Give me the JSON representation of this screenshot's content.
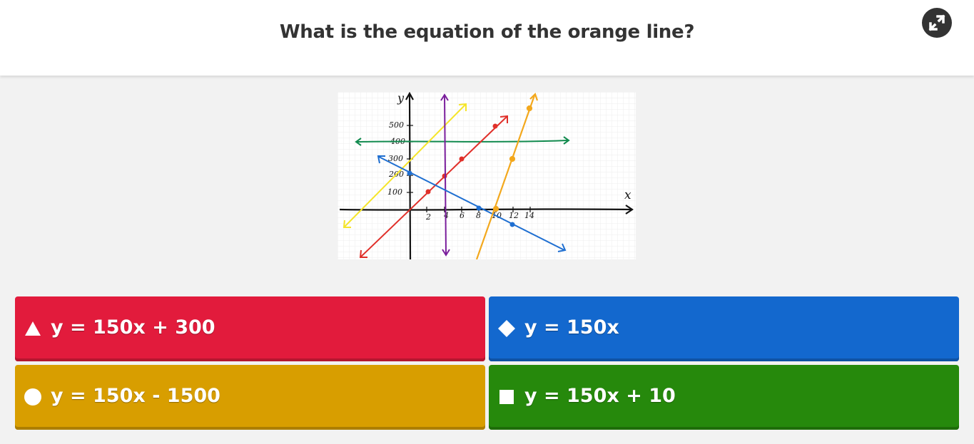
{
  "question": {
    "text": "What is the equation of the orange line?"
  },
  "header": {
    "fullscreen_icon": "expand-icon"
  },
  "graph": {
    "x_axis_label": "x",
    "y_axis_label": "y",
    "x_ticks": [
      "2",
      "4",
      "6",
      "8",
      "10",
      "12",
      "14"
    ],
    "y_ticks": [
      "100",
      "200",
      "300",
      "400",
      "500"
    ],
    "line_colors": {
      "yellow": "#f5e52a",
      "purple": "#7a1e9c",
      "red": "#e0302a",
      "green": "#118a4e",
      "blue": "#1f6fd1",
      "orange": "#f3a81d"
    }
  },
  "answers": [
    {
      "shape": "triangle",
      "color": "#e21b3c",
      "text": "y = 150x + 300"
    },
    {
      "shape": "diamond",
      "color": "#1368ce",
      "text": "y = 150x"
    },
    {
      "shape": "circle",
      "color": "#d89e00",
      "text": "y = 150x - 1500"
    },
    {
      "shape": "square",
      "color": "#26890c",
      "text": "y = 150x + 10"
    }
  ]
}
